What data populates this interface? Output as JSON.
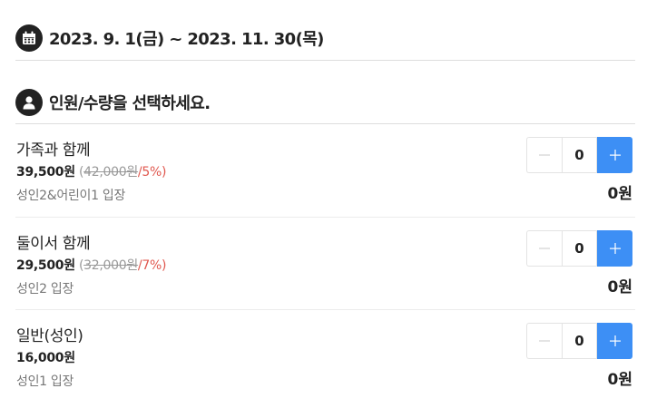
{
  "date_header": {
    "icon": "calendar-icon",
    "text": "2023. 9. 1(금) ~ 2023. 11. 30(목)"
  },
  "people_header": {
    "icon": "person-icon",
    "text": "인원/수량을 선택하세요."
  },
  "colors": {
    "accent": "#3d8ff5",
    "discount": "#e0584f",
    "divider": "#dddddd"
  },
  "items": [
    {
      "name": "가족과 함께",
      "price": "39,500원",
      "open_paren": "(",
      "original_price": "42,000원",
      "discount": "/5%)",
      "description": "성인2&어린이1 입장",
      "quantity": "0",
      "total": "0원"
    },
    {
      "name": "둘이서 함께",
      "price": "29,500원",
      "open_paren": "(",
      "original_price": "32,000원",
      "discount": "/7%)",
      "description": "성인2 입장",
      "quantity": "0",
      "total": "0원"
    },
    {
      "name": "일반(성인)",
      "price": "16,000원",
      "description": "성인1 입장",
      "quantity": "0",
      "total": "0원"
    }
  ]
}
